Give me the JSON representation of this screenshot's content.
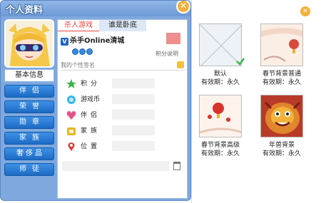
{
  "window": {
    "title": "个人资料"
  },
  "nav": {
    "basic_info": "基本信息",
    "items": [
      "伴侣",
      "荣誉",
      "勋章",
      "家族",
      "奢侈品",
      "师徒"
    ]
  },
  "tabs": {
    "active": "杀人游戏",
    "inactive": "谁是卧底"
  },
  "profile": {
    "username": "杀手Online清城",
    "vip_label": "Ⅴ",
    "score_link": "积分说明",
    "signature_placeholder": "我的个性签名"
  },
  "stats": [
    {
      "label": "积分",
      "icon": "star-icon"
    },
    {
      "label": "游戏币",
      "icon": "coin-icon"
    },
    {
      "label": "伴侣",
      "icon": "heart-icon"
    },
    {
      "label": "家族",
      "icon": "family-icon"
    },
    {
      "label": "位置",
      "icon": "location-icon"
    }
  ],
  "backgrounds": {
    "cards": [
      {
        "name": "默认",
        "valid_label": "有效期：",
        "valid_value": "永久",
        "selected": true
      },
      {
        "name": "春节背景普通",
        "valid_label": "有效期：",
        "valid_value": "永久",
        "selected": false
      },
      {
        "name": "春节背景高级",
        "valid_label": "有效期：",
        "valid_value": "永久",
        "selected": false
      },
      {
        "name": "年兽背景",
        "valid_label": "有效期：",
        "valid_value": "永久",
        "selected": false
      }
    ]
  },
  "colors": {
    "frame_blue": "#7fa9de",
    "nav_blue": "#1c6bc4",
    "tab_red": "#e8433c",
    "close_orange": "#f2b13a",
    "check_green": "#3cb44a"
  }
}
